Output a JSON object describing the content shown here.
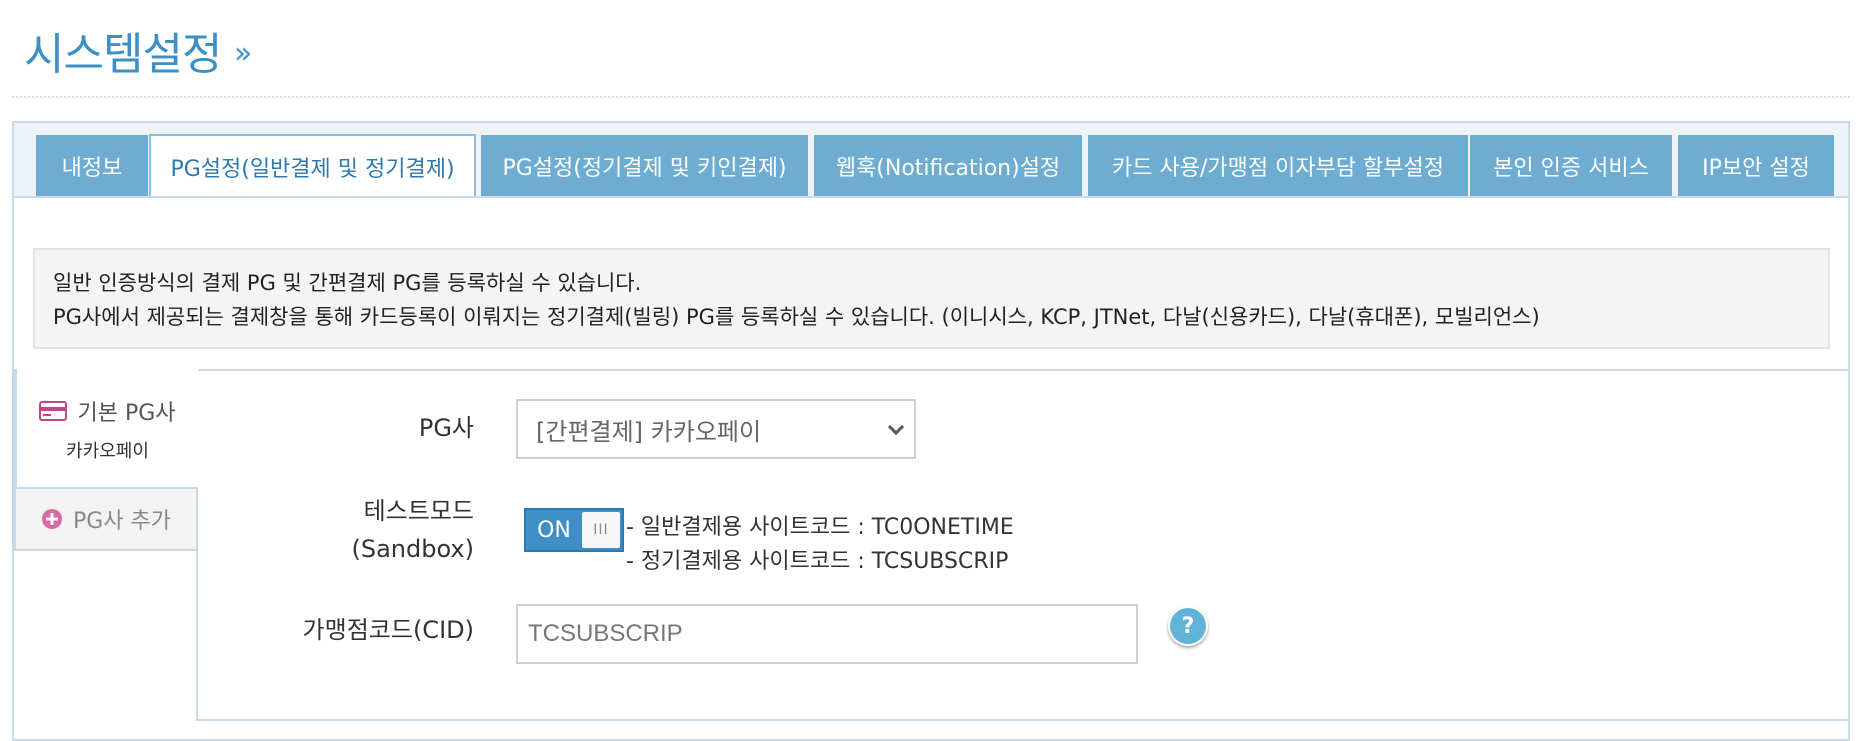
{
  "header": {
    "title": "시스템설정",
    "arrow": "»"
  },
  "tabs": [
    {
      "label": "내정보",
      "active": false
    },
    {
      "label": "PG설정(일반결제 및 정기결제)",
      "active": true
    },
    {
      "label": "PG설정(정기결제 및 키인결제)",
      "active": false
    },
    {
      "label": "웹훅(Notification)설정",
      "active": false
    },
    {
      "label": "카드 사용/가맹점 이자부담 할부설정",
      "active": false
    },
    {
      "label": "본인 인증 서비스",
      "active": false
    },
    {
      "label": "IP보안 설정",
      "active": false
    }
  ],
  "info": {
    "line1": "일반 인증방식의 결제 PG 및 간편결제 PG를 등록하실 수 있습니다.",
    "line2": "PG사에서 제공되는 결제창을 통해 카드등록이 이뤄지는 정기결제(빌링) PG를 등록하실 수 있습니다. (이니시스, KCP, JTNet, 다날(신용카드), 다날(휴대폰), 모빌리언스)"
  },
  "sidebar": {
    "default_title": "기본 PG사",
    "default_value": "카카오페이",
    "add_label": "PG사 추가"
  },
  "form": {
    "pg_label": "PG사",
    "pg_selected": "[간편결제] 카카오페이",
    "testmode_label_line1": "테스트모드",
    "testmode_label_line2": "(Sandbox)",
    "toggle_on": "ON",
    "toggle_knob": "III",
    "note1": "- 일반결제용 사이트코드 : TC0ONETIME",
    "note2": "- 정기결제용 사이트코드 : TCSUBSCRIP",
    "cid_label": "가맹점코드(CID)",
    "cid_value": "TCSUBSCRIP",
    "help": "?"
  },
  "colors": {
    "accent": "#3d8fc6",
    "tab_bg": "#6eacd1",
    "card_icon": "#c0488a",
    "help_bg": "#5fb4d8"
  },
  "icons": [
    "chevron-down-icon",
    "credit-card-icon",
    "plus-circle-icon",
    "help-icon"
  ]
}
